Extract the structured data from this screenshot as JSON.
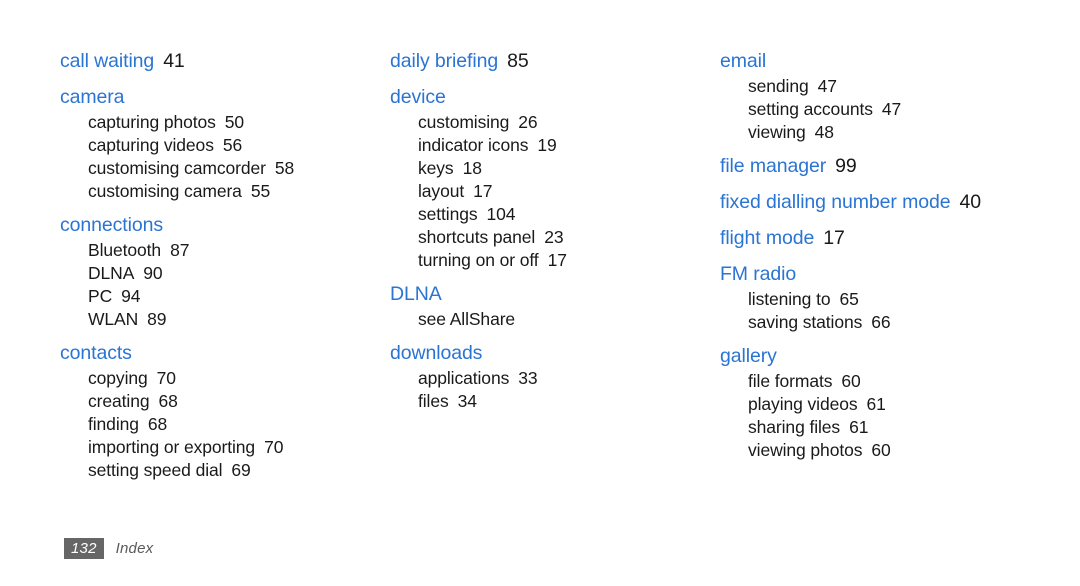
{
  "document": {
    "section_title": "Index",
    "page_number": "132",
    "accent_color": "#2a74d4",
    "text_color": "#1a1a1a",
    "footer_box_color": "#666666",
    "background_color": "#ffffff"
  },
  "columns": [
    {
      "groups": [
        {
          "headword": "call waiting",
          "page": "41",
          "subentries": []
        },
        {
          "headword": "camera",
          "page": "",
          "subentries": [
            {
              "label": "capturing photos",
              "page": "50"
            },
            {
              "label": "capturing videos",
              "page": "56"
            },
            {
              "label": "customising camcorder",
              "page": "58"
            },
            {
              "label": "customising camera",
              "page": "55"
            }
          ]
        },
        {
          "headword": "connections",
          "page": "",
          "subentries": [
            {
              "label": "Bluetooth",
              "page": "87"
            },
            {
              "label": "DLNA",
              "page": "90"
            },
            {
              "label": "PC",
              "page": "94"
            },
            {
              "label": "WLAN",
              "page": "89"
            }
          ]
        },
        {
          "headword": "contacts",
          "page": "",
          "subentries": [
            {
              "label": "copying",
              "page": "70"
            },
            {
              "label": "creating",
              "page": "68"
            },
            {
              "label": "finding",
              "page": "68"
            },
            {
              "label": "importing or exporting",
              "page": "70"
            },
            {
              "label": "setting speed dial",
              "page": "69"
            }
          ]
        }
      ]
    },
    {
      "groups": [
        {
          "headword": "daily briefing",
          "page": "85",
          "subentries": []
        },
        {
          "headword": "device",
          "page": "",
          "subentries": [
            {
              "label": "customising",
              "page": "26"
            },
            {
              "label": "indicator icons",
              "page": "19"
            },
            {
              "label": "keys",
              "page": "18"
            },
            {
              "label": "layout",
              "page": "17"
            },
            {
              "label": "settings",
              "page": "104"
            },
            {
              "label": "shortcuts panel",
              "page": "23"
            },
            {
              "label": "turning on or off",
              "page": "17"
            }
          ]
        },
        {
          "headword": "DLNA",
          "page": "",
          "subentries": [
            {
              "label": "see AllShare",
              "page": ""
            }
          ]
        },
        {
          "headword": "downloads",
          "page": "",
          "subentries": [
            {
              "label": "applications",
              "page": "33"
            },
            {
              "label": "files",
              "page": "34"
            }
          ]
        }
      ]
    },
    {
      "groups": [
        {
          "headword": "email",
          "page": "",
          "subentries": [
            {
              "label": "sending",
              "page": "47"
            },
            {
              "label": "setting accounts",
              "page": "47"
            },
            {
              "label": "viewing",
              "page": "48"
            }
          ]
        },
        {
          "headword": "file manager",
          "page": "99",
          "subentries": []
        },
        {
          "headword": "fixed dialling number mode",
          "page": "40",
          "subentries": []
        },
        {
          "headword": "flight mode",
          "page": "17",
          "subentries": []
        },
        {
          "headword": "FM radio",
          "page": "",
          "subentries": [
            {
              "label": "listening to",
              "page": "65"
            },
            {
              "label": "saving stations",
              "page": "66"
            }
          ]
        },
        {
          "headword": "gallery",
          "page": "",
          "subentries": [
            {
              "label": "file formats",
              "page": "60"
            },
            {
              "label": "playing videos",
              "page": "61"
            },
            {
              "label": "sharing files",
              "page": "61"
            },
            {
              "label": "viewing photos",
              "page": "60"
            }
          ]
        }
      ]
    }
  ]
}
